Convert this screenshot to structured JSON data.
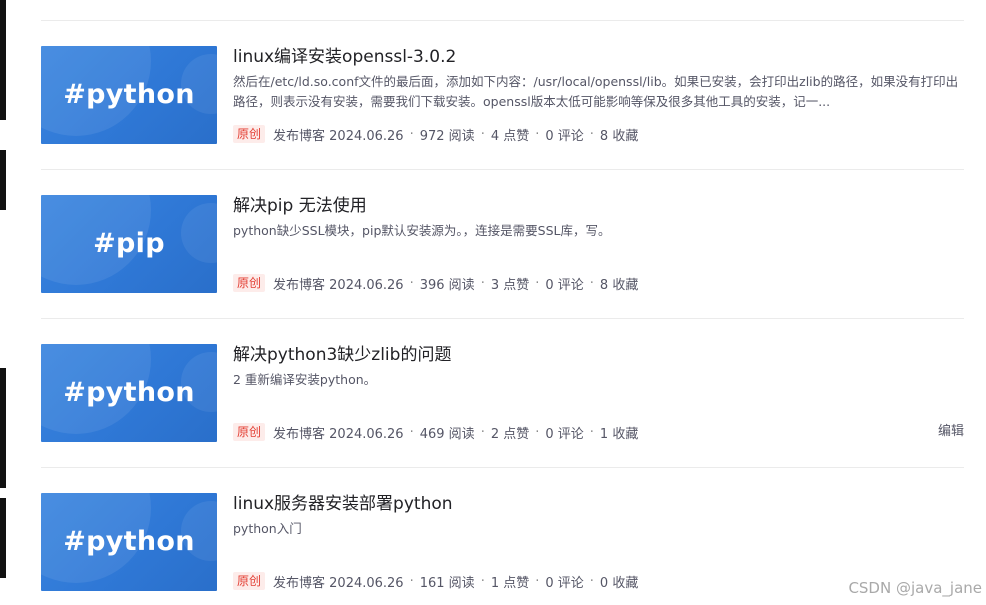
{
  "articles": [
    {
      "thumb_text": "#python",
      "title": "linux编译安装openssl-3.0.2",
      "desc": "然后在/etc/ld.so.conf文件的最后面，添加如下内容：/usr/local/openssl/lib。如果已安装，会打印出zlib的路径，如果没有打印出路径，则表示没有安装，需要我们下载安装。openssl版本太低可能影响等保及很多其他工具的安装，记一...",
      "badge": "原创",
      "publish": "发布博客 2024.06.26",
      "reads": "972 阅读",
      "likes": "4 点赞",
      "comments": "0 评论",
      "favorites": "8 收藏"
    },
    {
      "thumb_text": "#pip",
      "title": "解决pip 无法使用",
      "desc": "python缺少SSL模块，pip默认安装源为。，连接是需要SSL库，写。",
      "badge": "原创",
      "publish": "发布博客 2024.06.26",
      "reads": "396 阅读",
      "likes": "3 点赞",
      "comments": "0 评论",
      "favorites": "8 收藏"
    },
    {
      "thumb_text": "#python",
      "title": "解决python3缺少zlib的问题",
      "desc": "2 重新编译安装python。",
      "badge": "原创",
      "publish": "发布博客 2024.06.26",
      "reads": "469 阅读",
      "likes": "2 点赞",
      "comments": "0 评论",
      "favorites": "1 收藏",
      "edit": "编辑"
    },
    {
      "thumb_text": "#python",
      "title": "linux服务器安装部署python",
      "desc": "python入门",
      "badge": "原创",
      "publish": "发布博客 2024.06.26",
      "reads": "161 阅读",
      "likes": "1 点赞",
      "comments": "0 评论",
      "favorites": "0 收藏"
    }
  ],
  "separator": "·",
  "watermark": "CSDN @java_jane"
}
